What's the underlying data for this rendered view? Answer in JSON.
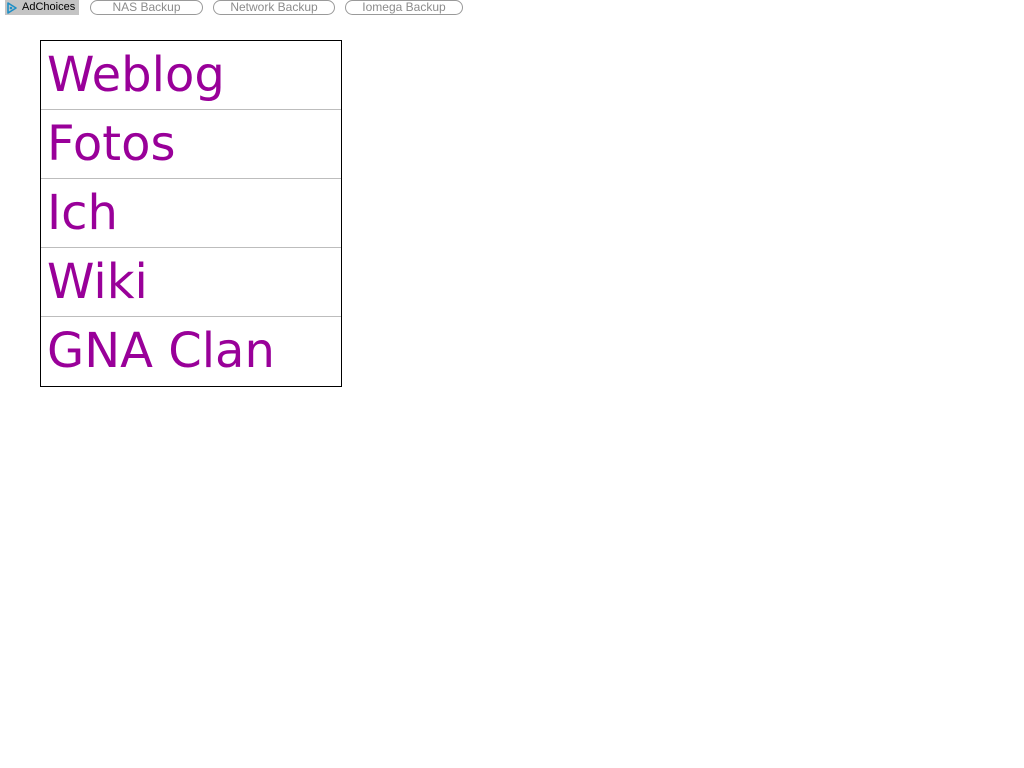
{
  "ad_bar": {
    "adchoices_label": "AdChoices",
    "links": [
      {
        "label": "NAS Backup"
      },
      {
        "label": "Network Backup"
      },
      {
        "label": "Iomega Backup"
      }
    ]
  },
  "nav": {
    "link_color": "#990099",
    "items": [
      {
        "label": "Weblog"
      },
      {
        "label": "Fotos"
      },
      {
        "label": "Ich"
      },
      {
        "label": "Wiki"
      },
      {
        "label": "GNA Clan"
      }
    ]
  }
}
